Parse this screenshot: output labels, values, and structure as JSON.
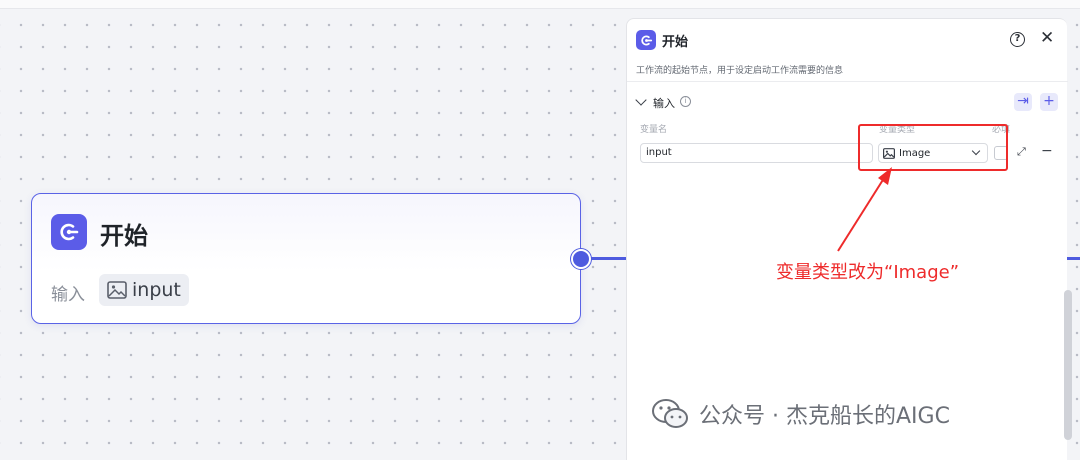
{
  "node": {
    "title": "开始",
    "input_label": "输入",
    "tag": "input",
    "icon": "start-node-icon",
    "accent_color": "#5b5ce8"
  },
  "panel": {
    "title": "开始",
    "description": "工作流的起始节点，用于设定启动工作流需要的信息",
    "section_title": "输入",
    "columns": {
      "name": "变量名",
      "type": "变量类型",
      "required": "必填"
    },
    "variable": {
      "name": "input",
      "type": "Image",
      "required": false
    }
  },
  "annotation": {
    "text": "变量类型改为“Image”",
    "color": "#ee2b2b"
  },
  "watermark": {
    "text": "公众号 · 杰克船长的AIGC"
  }
}
